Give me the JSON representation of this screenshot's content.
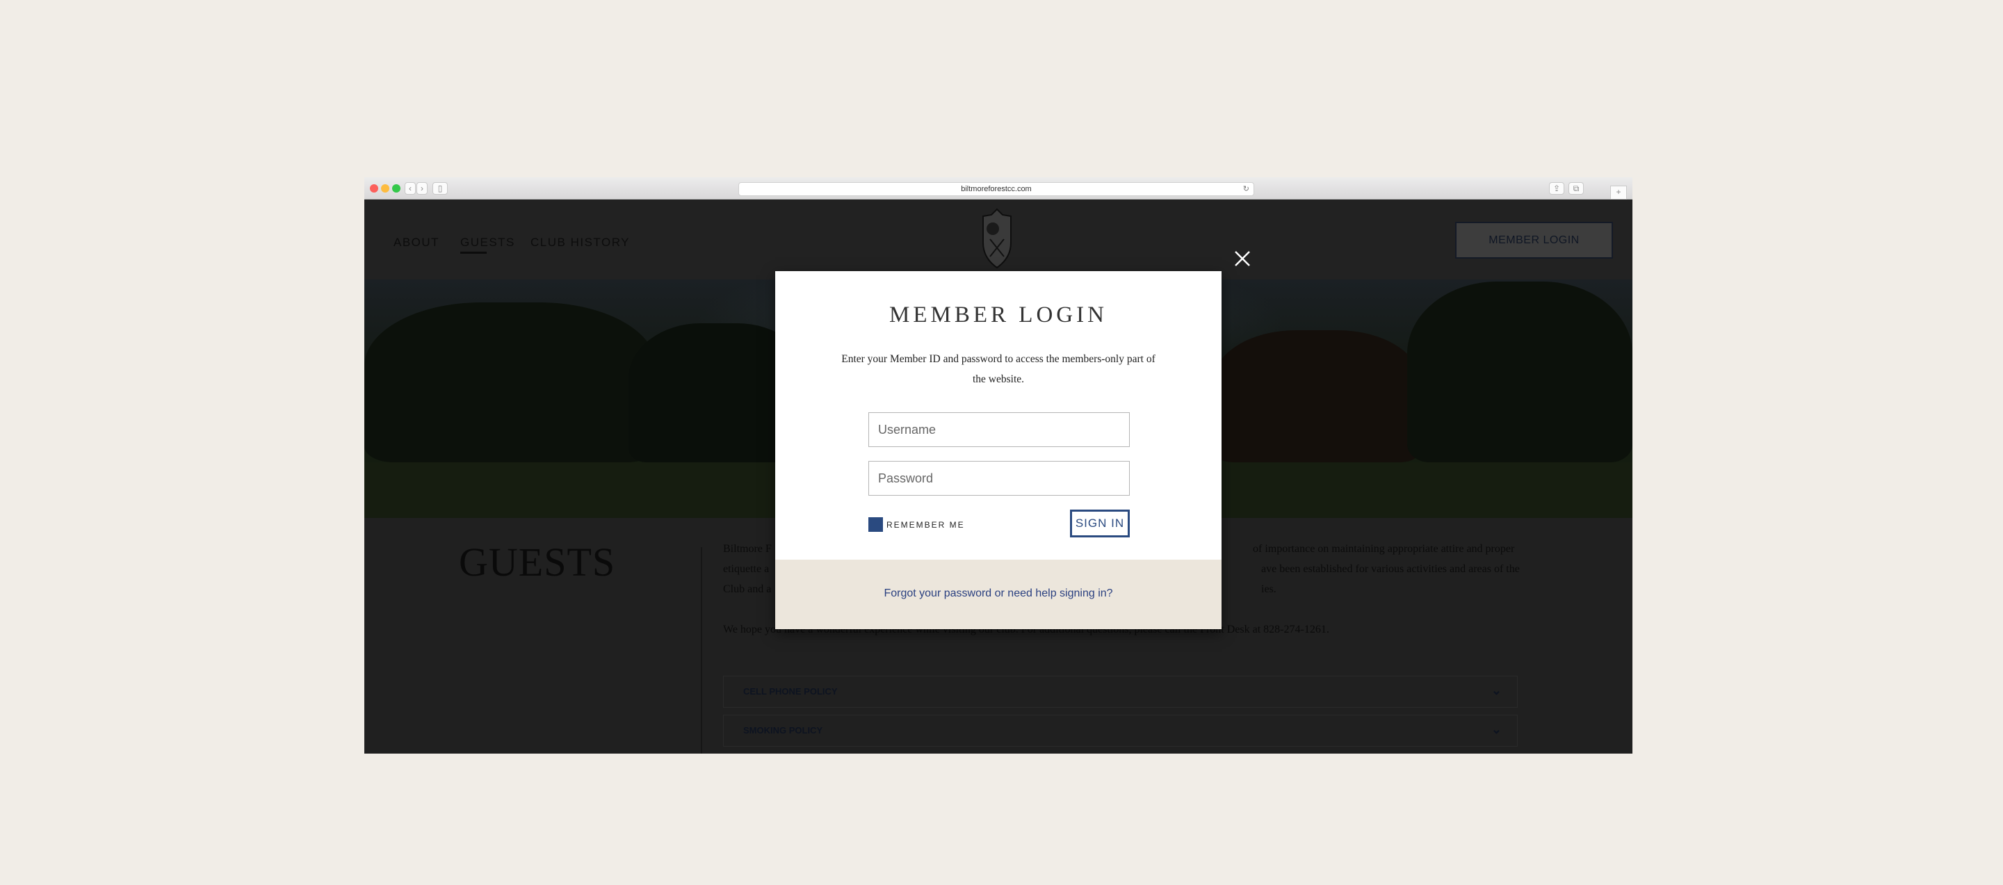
{
  "browser": {
    "url": "biltmoreforestcc.com",
    "traffic_colors": [
      "#fc605c",
      "#fdbc40",
      "#34c84a"
    ]
  },
  "nav": {
    "items": [
      "ABOUT",
      "GUESTS",
      "CLUB HISTORY"
    ],
    "active": "GUESTS",
    "member_login": "MEMBER LOGIN"
  },
  "page": {
    "heading": "GUESTS",
    "para1": [
      {
        "start": "Biltmore F",
        "end": "of importance on maintaining appropriate attire and proper"
      },
      {
        "start": "etiquette a",
        "end": "ave been established for various activities and areas of the"
      },
      {
        "start": "Club and a",
        "end": "ies."
      }
    ],
    "para2": "We hope you have a wonderful experience while visiting our club. For additional questions, please call the Front Desk at 828-274-1261.",
    "accordions": [
      "CELL PHONE POLICY",
      "SMOKING POLICY"
    ]
  },
  "modal": {
    "title": "MEMBER LOGIN",
    "description": "Enter your Member ID and password to access the members-only part of the website.",
    "username_placeholder": "Username",
    "password_placeholder": "Password",
    "remember_me": "REMEMBER ME",
    "remember_checked": true,
    "sign_in": "SIGN IN",
    "forgot": "Forgot your password or need help signing in?",
    "accent": "#2a4a80"
  }
}
